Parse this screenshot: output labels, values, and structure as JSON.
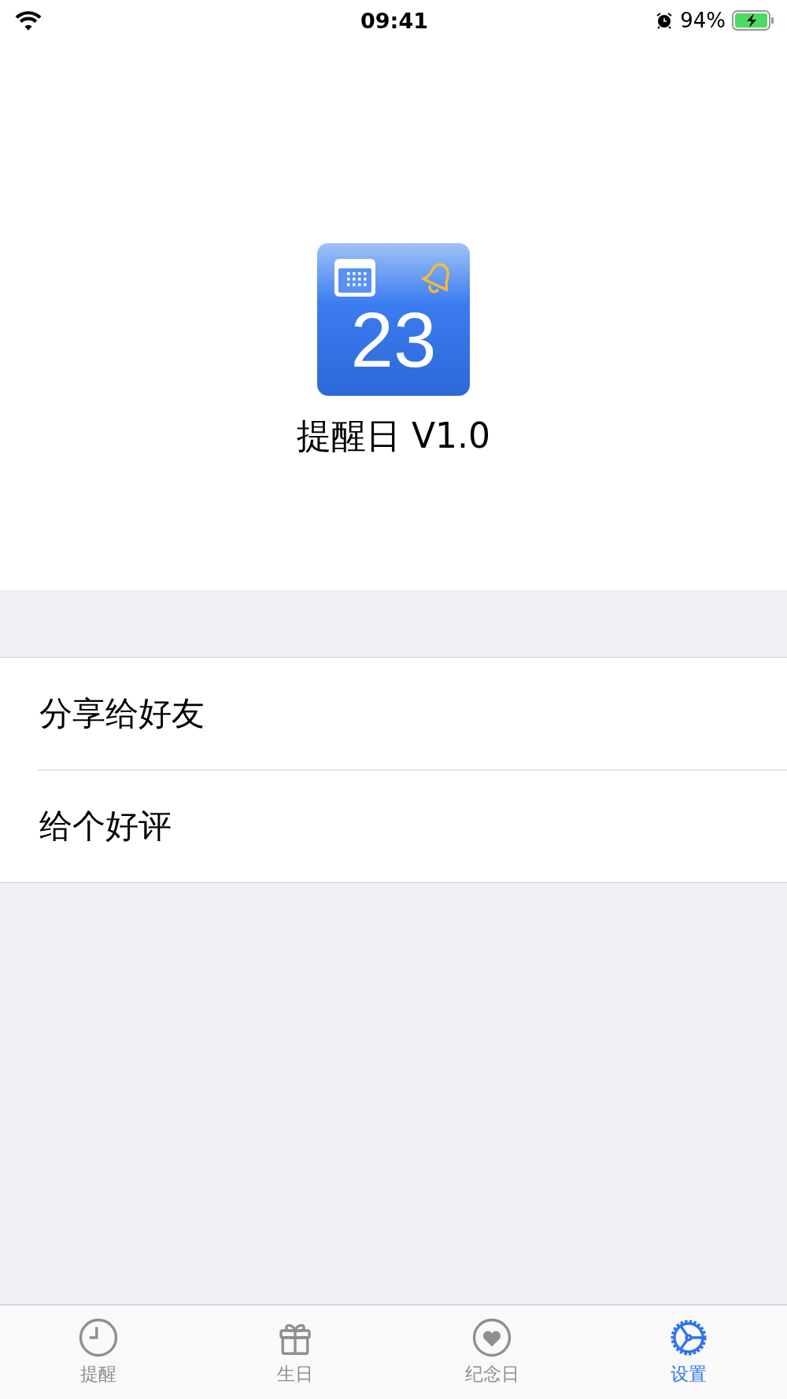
{
  "status_bar": {
    "time": "09:41",
    "battery": "94%"
  },
  "app": {
    "icon_number": "23",
    "title": "提醒日 V1.0"
  },
  "menu": [
    {
      "label": "分享给好友"
    },
    {
      "label": "给个好评"
    }
  ],
  "tab_bar": [
    {
      "label": "提醒",
      "kind": "clock",
      "selected": false
    },
    {
      "label": "生日",
      "kind": "gift",
      "selected": false
    },
    {
      "label": "纪念日",
      "kind": "heart",
      "selected": false
    },
    {
      "label": "设置",
      "kind": "gear",
      "selected": true
    }
  ]
}
